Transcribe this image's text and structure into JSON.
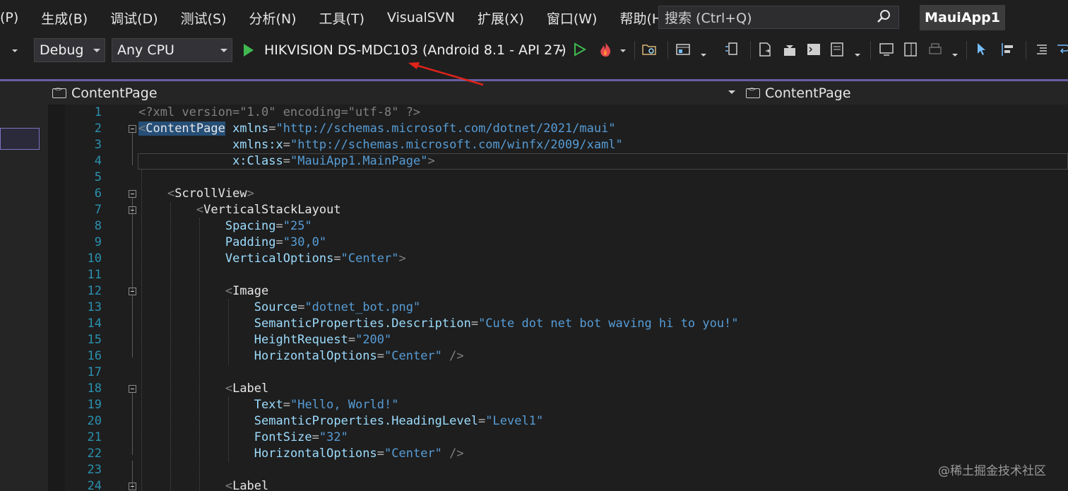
{
  "menubar": {
    "items": [
      "(P)",
      "生成(B)",
      "调试(D)",
      "测试(S)",
      "分析(N)",
      "工具(T)",
      "VisualSVN",
      "扩展(X)",
      "窗口(W)",
      "帮助(H)"
    ],
    "search_placeholder": "搜索 (Ctrl+Q)",
    "app_title": "MauiApp1"
  },
  "toolbar": {
    "config": "Debug",
    "platform": "Any CPU",
    "run_target": "HIKVISION DS-MDC103 (Android 8.1 - API 27)"
  },
  "navbar": {
    "left": "ContentPage",
    "right": "ContentPage"
  },
  "editor": {
    "lines": [
      {
        "n": "1",
        "c": "<?xml version=\"1.0\" encoding=\"utf-8\" ?>"
      },
      {
        "n": "2",
        "c": "<ContentPage xmlns=\"http://schemas.microsoft.com/dotnet/2021/maui\""
      },
      {
        "n": "3",
        "c": "             xmlns:x=\"http://schemas.microsoft.com/winfx/2009/xaml\""
      },
      {
        "n": "4",
        "c": "             x:Class=\"MauiApp1.MainPage\">"
      },
      {
        "n": "5",
        "c": ""
      },
      {
        "n": "6",
        "c": "    <ScrollView>"
      },
      {
        "n": "7",
        "c": "        <VerticalStackLayout"
      },
      {
        "n": "8",
        "c": "            Spacing=\"25\""
      },
      {
        "n": "9",
        "c": "            Padding=\"30,0\""
      },
      {
        "n": "10",
        "c": "            VerticalOptions=\"Center\">"
      },
      {
        "n": "11",
        "c": ""
      },
      {
        "n": "12",
        "c": "            <Image"
      },
      {
        "n": "13",
        "c": "                Source=\"dotnet_bot.png\""
      },
      {
        "n": "14",
        "c": "                SemanticProperties.Description=\"Cute dot net bot waving hi to you!\""
      },
      {
        "n": "15",
        "c": "                HeightRequest=\"200\""
      },
      {
        "n": "16",
        "c": "                HorizontalOptions=\"Center\" />"
      },
      {
        "n": "17",
        "c": ""
      },
      {
        "n": "18",
        "c": "            <Label"
      },
      {
        "n": "19",
        "c": "                Text=\"Hello, World!\""
      },
      {
        "n": "20",
        "c": "                SemanticProperties.HeadingLevel=\"Level1\""
      },
      {
        "n": "21",
        "c": "                FontSize=\"32\""
      },
      {
        "n": "22",
        "c": "                HorizontalOptions=\"Center\" />"
      },
      {
        "n": "23",
        "c": ""
      },
      {
        "n": "24",
        "c": "            <Label"
      }
    ]
  },
  "watermark": "@稀土掘金技术社区"
}
